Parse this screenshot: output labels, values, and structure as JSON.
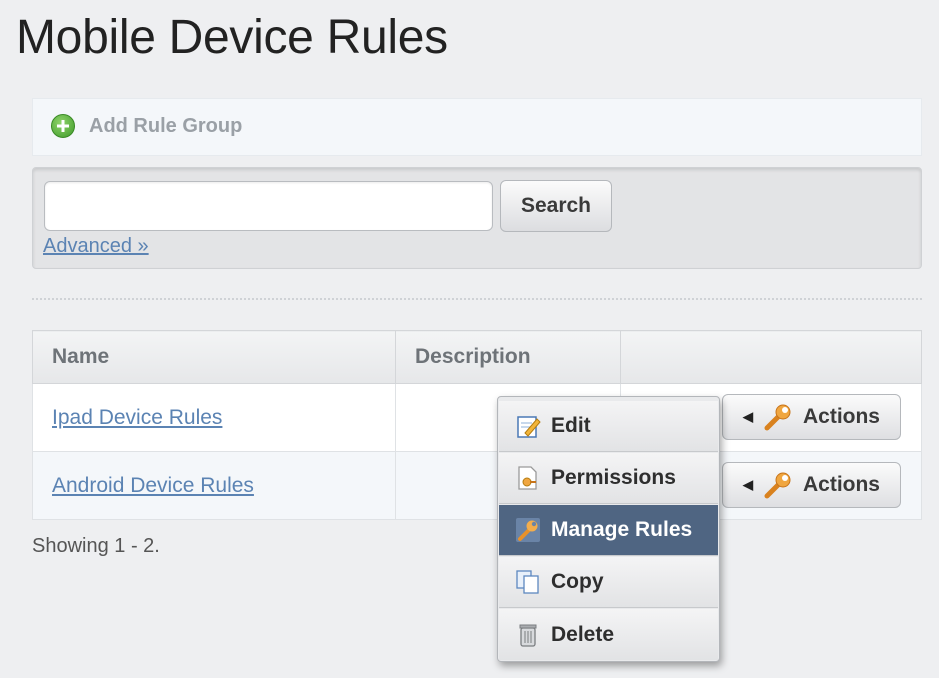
{
  "page": {
    "title": "Mobile Device Rules"
  },
  "toolbar": {
    "add_label": "Add Rule Group"
  },
  "search": {
    "value": "",
    "placeholder": "",
    "button_label": "Search",
    "advanced_label": "Advanced »"
  },
  "table": {
    "columns": [
      "Name",
      "Description",
      ""
    ],
    "rows": [
      {
        "name": "Ipad Device Rules",
        "description": "",
        "actions_label": "Actions"
      },
      {
        "name": "Android Device Rules",
        "description": "",
        "actions_label": "Actions"
      }
    ]
  },
  "footer": {
    "showing": "Showing 1 - 2."
  },
  "actions_menu": {
    "items": [
      {
        "label": "Edit",
        "icon": "edit-icon"
      },
      {
        "label": "Permissions",
        "icon": "permissions-icon"
      },
      {
        "label": "Manage Rules",
        "icon": "wrench-icon",
        "highlighted": true
      },
      {
        "label": "Copy",
        "icon": "copy-icon"
      },
      {
        "label": "Delete",
        "icon": "trash-icon"
      }
    ]
  },
  "colors": {
    "link": "#5b83b3",
    "menu_highlight": "#4f6582",
    "add_icon": "#3f9a2a",
    "wrench": "#e8912a"
  }
}
